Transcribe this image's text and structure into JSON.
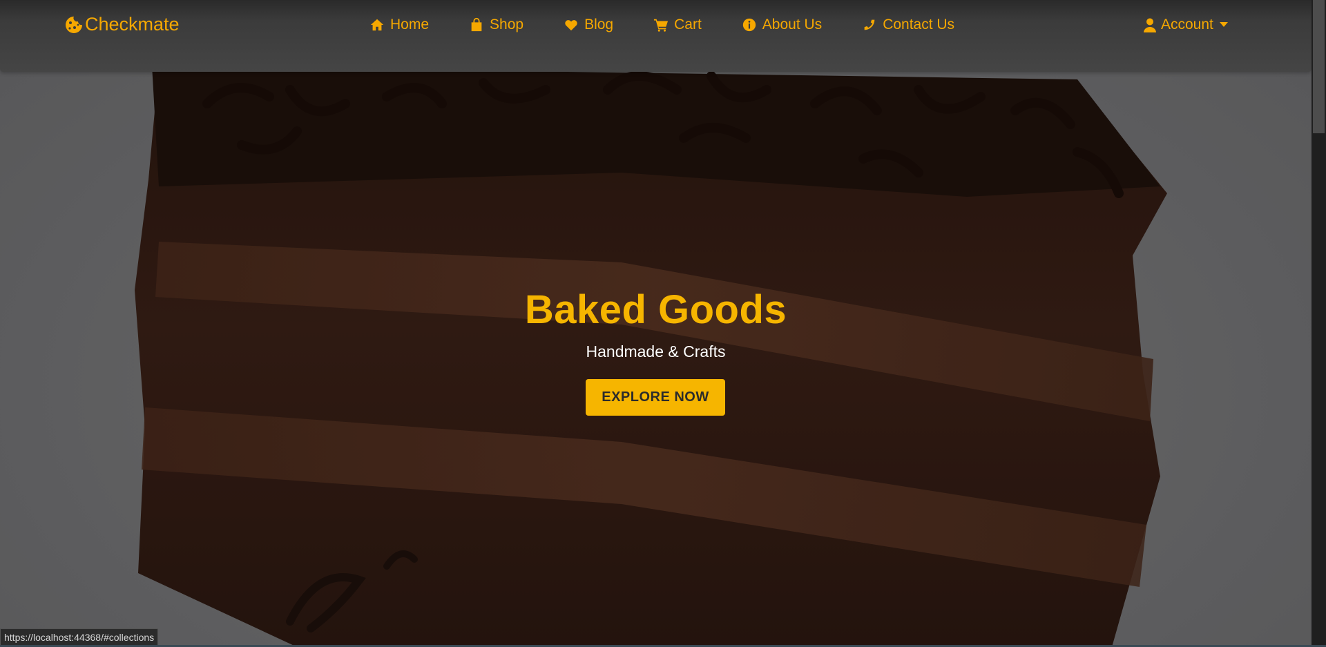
{
  "brand": {
    "name": "Checkmate",
    "icon": "cookie-icon"
  },
  "nav": {
    "items": [
      {
        "label": "Home",
        "icon": "home-icon"
      },
      {
        "label": "Shop",
        "icon": "shopping-bag-icon"
      },
      {
        "label": "Blog",
        "icon": "heart-icon"
      },
      {
        "label": "Cart",
        "icon": "cart-icon"
      },
      {
        "label": "About Us",
        "icon": "info-circle-icon"
      },
      {
        "label": "Contact Us",
        "icon": "phone-icon"
      }
    ],
    "account": {
      "label": "Account",
      "icon": "user-icon"
    }
  },
  "hero": {
    "title": "Baked Goods",
    "subtitle": "Handmade & Crafts",
    "button_label": "EXPLORE NOW"
  },
  "status_bar": {
    "url": "https://localhost:44368/#collections"
  },
  "colors": {
    "accent": "#f6b500",
    "nav_text": "#f6a800",
    "navbar_bg": "#3b3b3b",
    "button_text": "#2b2b2b"
  }
}
